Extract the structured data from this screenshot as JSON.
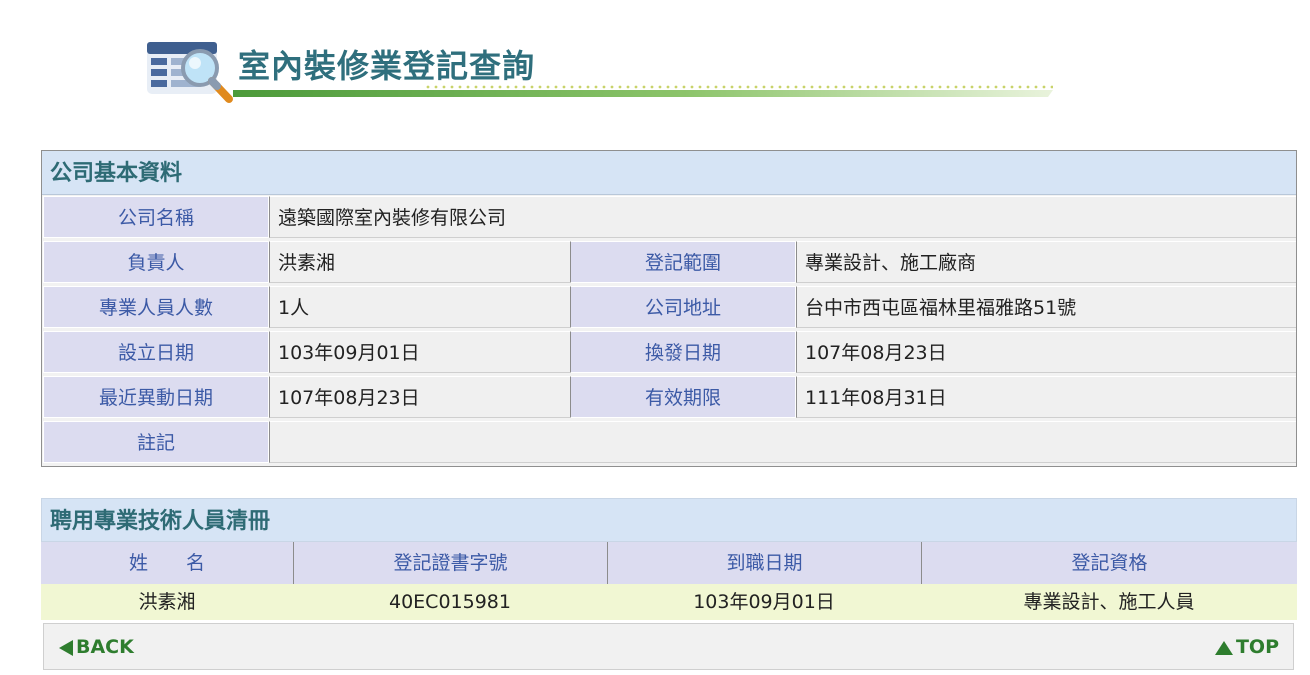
{
  "page_title": "室內裝修業登記查詢",
  "company_section": {
    "heading": "公司基本資料",
    "name_label": "公司名稱",
    "name_value": "遠築國際室內裝修有限公司",
    "owner_label": "負責人",
    "owner_value": "洪素湘",
    "scope_label": "登記範圍",
    "scope_value": "專業設計、施工廠商",
    "staff_count_label": "專業人員人數",
    "staff_count_value": "1人",
    "address_label": "公司地址",
    "address_value": "台中市西屯區福林里福雅路51號",
    "established_label": "設立日期",
    "established_value": "103年09月01日",
    "renewal_label": "換發日期",
    "renewal_value": "107年08月23日",
    "last_change_label": "最近異動日期",
    "last_change_value": "107年08月23日",
    "expiry_label": "有效期限",
    "expiry_value": "111年08月31日",
    "note_label": "註記",
    "note_value": ""
  },
  "staff_section": {
    "heading": "聘用專業技術人員清冊",
    "columns": [
      "姓　　名",
      "登記證書字號",
      "到職日期",
      "登記資格"
    ],
    "rows": [
      [
        "洪素湘",
        "40EC015981",
        "103年09月01日",
        "專業設計、施工人員"
      ]
    ]
  },
  "nav": {
    "back_label": "BACK",
    "top_label": "TOP"
  },
  "colors": {
    "title": "#2f6f7d",
    "heading_bg": "#d6e4f5",
    "label_bg": "#dcdcf0",
    "label_text": "#3c5aa6",
    "row_bg": "#f1f7d3",
    "nav_green": "#2e7d2e"
  },
  "icons": {
    "header_icon": "magnifier-over-list-icon",
    "back_icon": "triangle-left-icon",
    "top_icon": "triangle-up-icon"
  }
}
